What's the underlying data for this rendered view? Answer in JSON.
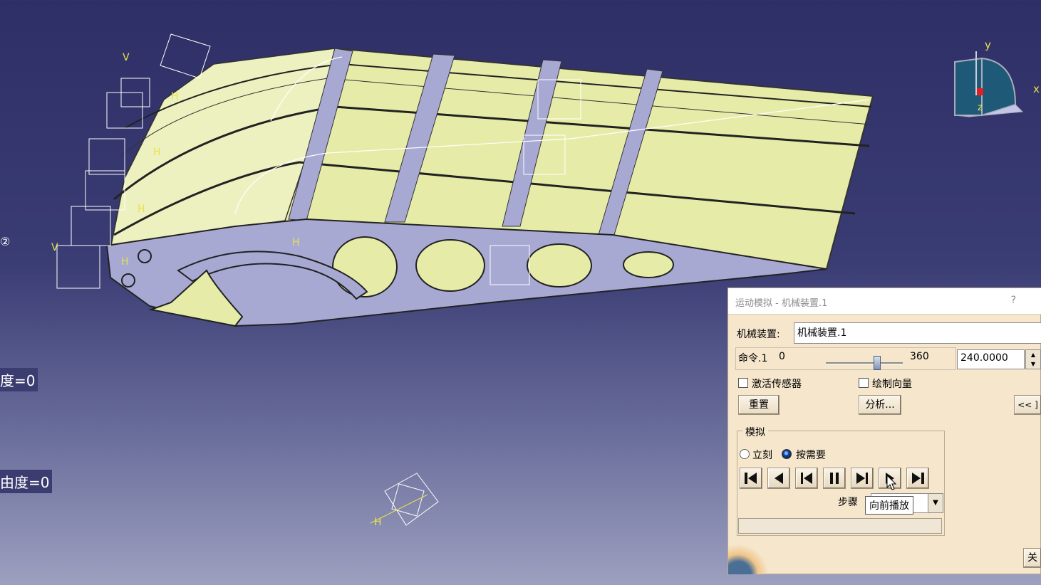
{
  "viewport": {
    "tree_labels": {
      "mark": "②",
      "dof_1": "度=0",
      "dof_2": "由度=0"
    },
    "compass": {
      "x_label": "x",
      "y_label": "y",
      "z_label": "z"
    },
    "model_label_h": "H",
    "model_label_v": "V"
  },
  "dialog": {
    "title": "运动模拟 - 机械装置.1",
    "help": "?",
    "mechanism_label": "机械装置:",
    "mechanism_value": "机械装置.1",
    "command_label": "命令.1",
    "slider_min": "0",
    "slider_max": "360",
    "slider_position": 0.667,
    "command_value": "240.0000",
    "activate_sensors_label": "激活传感器",
    "activate_sensors_checked": false,
    "plot_vectors_label": "绘制向量",
    "plot_vectors_checked": false,
    "reset_label": "重置",
    "analysis_label": "分析...",
    "collapse_label": "<< ]",
    "simulation_group": "模拟",
    "immediate_label": "立刻",
    "on_request_label": "按需要",
    "step_label": "步骤",
    "tooltip": "向前播放",
    "close_label": "关",
    "playback_buttons": [
      "jump-to-start",
      "play-backward",
      "step-backward",
      "pause",
      "step-forward",
      "play-forward",
      "jump-to-end"
    ]
  },
  "colors": {
    "skin": "#e6eca8",
    "rib": "#a7a9d3",
    "wire": "#ffffff",
    "axis": "#e8e24a",
    "dialog_bg": "#f5e6cc"
  }
}
